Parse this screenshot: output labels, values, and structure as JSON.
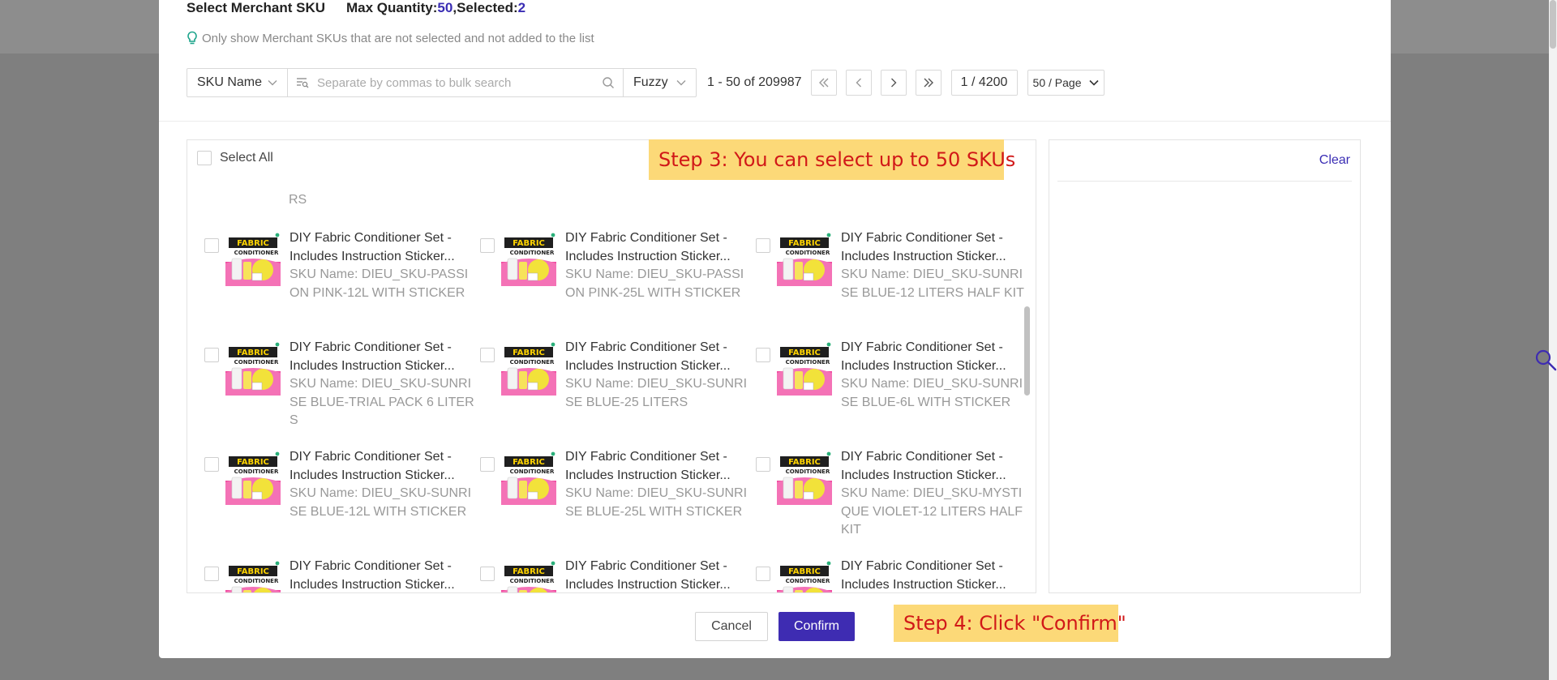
{
  "header": {
    "title": "Select Merchant SKU",
    "max_label": "Max Quantity: ",
    "max_value": "50",
    "sep": ", ",
    "selected_label": "Selected: ",
    "selected_value": "2"
  },
  "hint": "Only show Merchant SKUs that are not selected and not added to the list",
  "filter": {
    "field": "SKU Name",
    "search_placeholder": "Separate by commas to bulk search",
    "match": "Fuzzy"
  },
  "pagination": {
    "range": "1 - 50 of 209987",
    "page": "1 / 4200",
    "page_size": "50 / Page"
  },
  "list": {
    "select_all": "Select All",
    "overflow_text": "RS",
    "items": [
      {
        "title1": "DIY Fabric Conditioner Set -",
        "title2": "Includes Instruction Sticker...",
        "sku": "SKU Name: DIEU_SKU-PASSION PINK-12L WITH STICKER"
      },
      {
        "title1": "DIY Fabric Conditioner Set -",
        "title2": "Includes Instruction Sticker...",
        "sku": "SKU Name: DIEU_SKU-PASSION PINK-25L WITH STICKER"
      },
      {
        "title1": "DIY Fabric Conditioner Set -",
        "title2": "Includes Instruction Sticker...",
        "sku": "SKU Name: DIEU_SKU-SUNRISE BLUE-12 LITERS HALF KIT"
      },
      {
        "title1": "DIY Fabric Conditioner Set -",
        "title2": "Includes Instruction Sticker...",
        "sku": "SKU Name: DIEU_SKU-SUNRISE BLUE-TRIAL PACK 6 LITERS"
      },
      {
        "title1": "DIY Fabric Conditioner Set -",
        "title2": "Includes Instruction Sticker...",
        "sku": "SKU Name: DIEU_SKU-SUNRISE BLUE-25 LITERS"
      },
      {
        "title1": "DIY Fabric Conditioner Set -",
        "title2": "Includes Instruction Sticker...",
        "sku": "SKU Name: DIEU_SKU-SUNRISE BLUE-6L WITH STICKER"
      },
      {
        "title1": "DIY Fabric Conditioner Set -",
        "title2": "Includes Instruction Sticker...",
        "sku": "SKU Name: DIEU_SKU-SUNRISE BLUE-12L WITH STICKER"
      },
      {
        "title1": "DIY Fabric Conditioner Set -",
        "title2": "Includes Instruction Sticker...",
        "sku": "SKU Name: DIEU_SKU-SUNRISE BLUE-25L WITH STICKER"
      },
      {
        "title1": "DIY Fabric Conditioner Set -",
        "title2": "Includes Instruction Sticker...",
        "sku": "SKU Name: DIEU_SKU-MYSTIQUE VIOLET-12 LITERS HALF KIT"
      },
      {
        "title1": "DIY Fabric Conditioner Set -",
        "title2": "Includes Instruction Sticker...",
        "sku": ""
      },
      {
        "title1": "DIY Fabric Conditioner Set -",
        "title2": "Includes Instruction Sticker...",
        "sku": ""
      },
      {
        "title1": "DIY Fabric Conditioner Set -",
        "title2": "Includes Instruction Sticker...",
        "sku": ""
      }
    ]
  },
  "right_panel": {
    "clear": "Clear"
  },
  "annotations": {
    "step3": "Step 3: You can select up to 50 SKUs",
    "step4": "Step 4: Click \"Confirm\""
  },
  "footer": {
    "cancel": "Cancel",
    "confirm": "Confirm"
  },
  "colors": {
    "accent": "#3e2cb2",
    "callout_bg": "#fcd978",
    "callout_text": "#d11818"
  },
  "icons": [
    "lightbulb-icon",
    "chevron-down-icon",
    "filter-list-icon",
    "search-icon",
    "double-chevron-left-icon",
    "chevron-left-icon",
    "chevron-right-icon",
    "double-chevron-right-icon",
    "product-thumbnail"
  ]
}
